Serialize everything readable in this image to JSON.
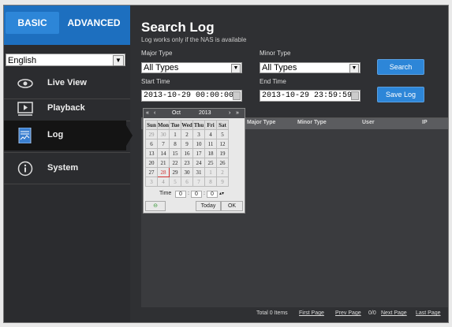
{
  "tabs": {
    "basic": "BASIC",
    "advanced": "ADVANCED"
  },
  "language": {
    "selected": "English"
  },
  "nav": [
    {
      "label": "Live View",
      "icon": "eye-icon"
    },
    {
      "label": "Playback",
      "icon": "play-icon"
    },
    {
      "label": "Log",
      "icon": "log-document-icon"
    },
    {
      "label": "System",
      "icon": "info-icon"
    }
  ],
  "main": {
    "title": "Search Log",
    "subtitle": "Log works only if the NAS is available",
    "major_type_label": "Major Type",
    "major_type_value": "All Types",
    "minor_type_label": "Minor Type",
    "minor_type_value": "All Types",
    "start_time_label": "Start Time",
    "start_time_value": "2013-10-29 00:00:00",
    "end_time_label": "End Time",
    "end_time_value": "2013-10-29 23:59:59",
    "search_button": "Search",
    "save_log_button": "Save Log"
  },
  "table": {
    "columns": [
      "Major Type",
      "Minor Type",
      "User",
      "IP"
    ]
  },
  "footer": {
    "total": "Total 0 Items",
    "first": "First Page",
    "prev": "Prev Page",
    "pages": "0/0",
    "next": "Next Page",
    "last": "Last Page"
  },
  "calendar": {
    "prev_year": "«",
    "prev_month": "‹",
    "month": "Oct",
    "year": "2013",
    "next_month": "›",
    "next_year": "»",
    "weekdays": [
      "Sun",
      "Mon",
      "Tue",
      "Wed",
      "Thu",
      "Fri",
      "Sat"
    ],
    "weeks": [
      [
        "29",
        "30",
        "1",
        "2",
        "3",
        "4",
        "5"
      ],
      [
        "6",
        "7",
        "8",
        "9",
        "10",
        "11",
        "12"
      ],
      [
        "13",
        "14",
        "15",
        "16",
        "17",
        "18",
        "19"
      ],
      [
        "20",
        "21",
        "22",
        "23",
        "24",
        "25",
        "26"
      ],
      [
        "27",
        "28",
        "29",
        "30",
        "31",
        "1",
        "2"
      ],
      [
        "3",
        "4",
        "5",
        "6",
        "7",
        "8",
        "9"
      ]
    ],
    "selected": "28",
    "time_label": "Time",
    "hour": "0",
    "minute": "0",
    "second": "0",
    "today_button": "Today",
    "ok_button": "OK"
  }
}
